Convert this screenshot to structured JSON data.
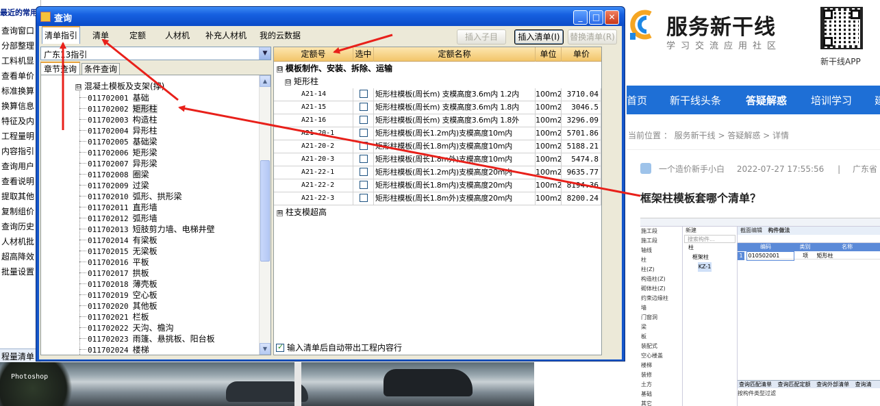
{
  "left_app": {
    "title": "最近的常用工",
    "items": [
      "查询窗口",
      "分部整理",
      "工料机显",
      "查看单价",
      "标准换算",
      "换算信息",
      "特征及内",
      "工程量明",
      "内容指引",
      "查询用户",
      "查看说明",
      "提取其他",
      "复制组价",
      "查询历史",
      "人材机批",
      "超高降效",
      "批量设置"
    ],
    "bottom_label": "程量清单"
  },
  "photo": {
    "watermark": "Photoshop"
  },
  "dialog": {
    "title": "查询",
    "window_buttons": {
      "minimize": "_",
      "maximize": "□",
      "close": "✕"
    },
    "tabs": [
      "清单指引",
      "清单",
      "定额",
      "人材机",
      "补充人材机",
      "我的云数据"
    ],
    "active_tab": "清单指引",
    "toolbar": {
      "insert_child": "插入子目",
      "insert_list": "插入清单(I)",
      "replace_list": "替换清单(R)"
    },
    "combo_value": "广东13指引",
    "subtabs": [
      "章节查询",
      "条件查询"
    ],
    "tree": {
      "parent_sign": "⊟",
      "parent": "混凝土模板及支架(撑)",
      "selected_code": "011702002",
      "nodes": [
        {
          "code": "011702001",
          "name": "基础"
        },
        {
          "code": "011702002",
          "name": "矩形柱"
        },
        {
          "code": "011702003",
          "name": "构造柱"
        },
        {
          "code": "011702004",
          "name": "异形柱"
        },
        {
          "code": "011702005",
          "name": "基础梁"
        },
        {
          "code": "011702006",
          "name": "矩形梁"
        },
        {
          "code": "011702007",
          "name": "异形梁"
        },
        {
          "code": "011702008",
          "name": "圈梁"
        },
        {
          "code": "011702009",
          "name": "过梁"
        },
        {
          "code": "011702010",
          "name": "弧形、拱形梁"
        },
        {
          "code": "011702011",
          "name": "直形墙"
        },
        {
          "code": "011702012",
          "name": "弧形墙"
        },
        {
          "code": "011702013",
          "name": "短肢剪力墙、电梯井壁"
        },
        {
          "code": "011702014",
          "name": "有梁板"
        },
        {
          "code": "011702015",
          "name": "无梁板"
        },
        {
          "code": "011702016",
          "name": "平板"
        },
        {
          "code": "011702017",
          "name": "拱板"
        },
        {
          "code": "011702018",
          "name": "薄壳板"
        },
        {
          "code": "011702019",
          "name": "空心板"
        },
        {
          "code": "011702020",
          "name": "其他板"
        },
        {
          "code": "011702021",
          "name": "栏板"
        },
        {
          "code": "011702022",
          "name": "天沟、檐沟"
        },
        {
          "code": "011702023",
          "name": "雨篷、悬挑板、阳台板"
        },
        {
          "code": "011702024",
          "name": "楼梯"
        }
      ]
    },
    "grid": {
      "headers": [
        "定额号",
        "选中",
        "定额名称",
        "单位",
        "单价"
      ],
      "group1": {
        "sign": "⊟",
        "label": "模板制作、安装、拆除、运输"
      },
      "group2": {
        "sign": "⊟",
        "label": "矩形柱"
      },
      "rows": [
        {
          "code": "A21-14",
          "name": "矩形柱模板(周长m) 支模高度3.6m内 1.2内",
          "unit": "100m2",
          "price": "3710.04"
        },
        {
          "code": "A21-15",
          "name": "矩形柱模板(周长m) 支模高度3.6m内 1.8内",
          "unit": "100m2",
          "price": "3046.5"
        },
        {
          "code": "A21-16",
          "name": "矩形柱模板(周长m) 支模高度3.6m内 1.8外",
          "unit": "100m2",
          "price": "3296.09"
        },
        {
          "code": "A21-20-1",
          "name": "矩形柱模板(周长1.2m内)支模高度10m内",
          "unit": "100m2",
          "price": "5701.86"
        },
        {
          "code": "A21-20-2",
          "name": "矩形柱模板(周长1.8m内)支模高度10m内",
          "unit": "100m2",
          "price": "5188.21"
        },
        {
          "code": "A21-20-3",
          "name": "矩形柱模板(周长1.8m外)支模高度10m内",
          "unit": "100m2",
          "price": "5474.8"
        },
        {
          "code": "A21-22-1",
          "name": "矩形柱模板(周长1.2m内)支模高度20m内",
          "unit": "100m2",
          "price": "9635.77"
        },
        {
          "code": "A21-22-2",
          "name": "矩形柱模板(周长1.8m内)支模高度20m内",
          "unit": "100m2",
          "price": "8194.36"
        },
        {
          "code": "A21-22-3",
          "name": "矩形柱模板(周长1.8m外)支模高度20m内",
          "unit": "100m2",
          "price": "8200.24"
        }
      ],
      "group3": {
        "sign": "⊞",
        "label": "柱支模超高"
      }
    },
    "bottom_checkbox": "输入清单后自动带出工程内容行"
  },
  "web": {
    "logo_title": "服务新干线",
    "logo_sub": "学习交流应用社区",
    "qr_label": "新干线APP",
    "nav": [
      "首页",
      "新干线头条",
      "答疑解惑",
      "培训学习",
      "建"
    ],
    "breadcrumb": "当前位置 ： 服务新干线 > 答疑解惑 > 详情",
    "meta": {
      "user": "一个造价新手小白",
      "time": "2022-07-27 17:55:56",
      "sep": "|",
      "location": "广东省 土"
    },
    "question": "框架柱模板套哪个清单？",
    "shot": {
      "left_items": [
        "施工段",
        "施工段",
        "轴线",
        "柱",
        "柱(Z)",
        "构造柱(Z)",
        "砌体柱(Z)",
        "约束边缘柱",
        "墙",
        "门窗洞",
        "梁",
        "板",
        "装配式",
        "空心楼盖",
        "楼梯",
        "装修",
        "土方",
        "基础",
        "其它"
      ],
      "tree_items": [
        "新建",
        "搜索构件...",
        "柱",
        "框架柱",
        "KZ-1"
      ],
      "tabs": [
        "截面编辑",
        "构件做法"
      ],
      "row": {
        "idx": "1",
        "code": "010502001",
        "type": "项",
        "name": "矩形柱"
      },
      "cols": [
        "编码",
        "类别",
        "名称"
      ],
      "bottom_tabs": [
        "查询匹配清单",
        "查询匹配定额",
        "查询外部清单",
        "查询清"
      ],
      "radio": "按构件类型过滤"
    }
  },
  "colors": {
    "arrow": "#e8201a",
    "title_bar": "#1660e0",
    "nav_blue": "#1e6fd6",
    "grid_header": "#f2c56a"
  }
}
